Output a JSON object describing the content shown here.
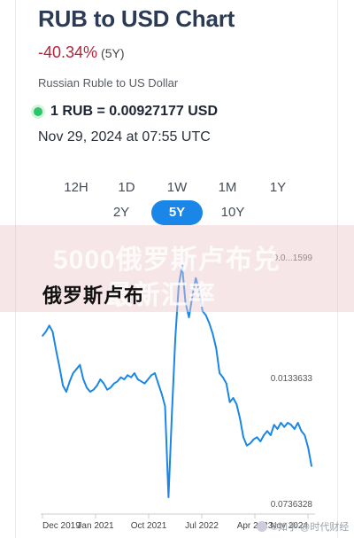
{
  "header": {
    "title": "RUB to USD Chart",
    "change": "-40.34%",
    "change_period": "(5Y)",
    "subtitle": "Russian Ruble to US Dollar",
    "rate": "1 RUB = 0.00927177 USD",
    "timestamp": "Nov 29, 2024 at 07:55 UTC"
  },
  "ranges": {
    "row1": [
      "12H",
      "1D",
      "1W",
      "1M",
      "1Y"
    ],
    "row2": [
      "2Y",
      "5Y",
      "10Y"
    ],
    "active": "5Y"
  },
  "overlay": {
    "line1": "5000俄罗斯卢布兑",
    "line2": "最新汇率",
    "heading": "俄罗斯卢布"
  },
  "watermark": "©知乎 @时代财经",
  "colors": {
    "accent": "#1a86e8",
    "negative": "#b3253b",
    "line": "#1a86e8",
    "live": "#2ec46b"
  },
  "chart_data": {
    "type": "line",
    "title": "",
    "xlabel": "",
    "ylabel": "",
    "x_ticks": [
      "Dec 2019",
      "Jan 2021",
      "Oct 2021",
      "Jul 2022",
      "Apr 2023",
      "Nov 2024"
    ],
    "y_ticks": [
      "0.0736328",
      "0.0133633",
      "0.0136...599"
    ],
    "y_tick_labels_visible": [
      "0.0736328",
      "0.0133633",
      "0.0...1599"
    ],
    "ylim": [
      0.0072,
      0.0195
    ],
    "series": [
      {
        "values": [
          0.0156,
          0.0158,
          0.0161,
          0.0158,
          0.0149,
          0.0141,
          0.0132,
          0.0129,
          0.0134,
          0.0138,
          0.014,
          0.0142,
          0.0135,
          0.0131,
          0.0129,
          0.013,
          0.0132,
          0.0135,
          0.0133,
          0.013,
          0.0131,
          0.0133,
          0.0134,
          0.0136,
          0.0135,
          0.0137,
          0.0136,
          0.0138,
          0.0135,
          0.0134,
          0.0133,
          0.0135,
          0.0137,
          0.0138,
          0.0133,
          0.0128,
          0.0122,
          0.0078,
          0.0118,
          0.0155,
          0.018,
          0.019,
          0.0172,
          0.0165,
          0.0175,
          0.0184,
          0.0178,
          0.0168,
          0.0166,
          0.0162,
          0.0157,
          0.015,
          0.0138,
          0.0136,
          0.0133,
          0.0124,
          0.0126,
          0.0123,
          0.0116,
          0.0107,
          0.0103,
          0.0104,
          0.0106,
          0.0107,
          0.0105,
          0.0108,
          0.011,
          0.0108,
          0.0113,
          0.0111,
          0.0114,
          0.0112,
          0.0114,
          0.0113,
          0.0111,
          0.0114,
          0.011,
          0.0108,
          0.0102,
          0.0093
        ]
      }
    ],
    "grid": false,
    "legend": "none"
  }
}
